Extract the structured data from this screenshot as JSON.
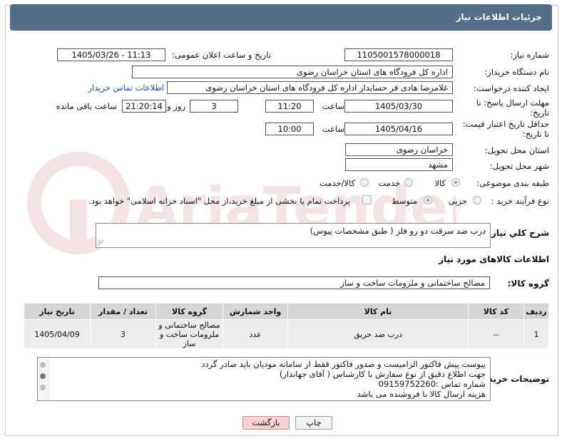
{
  "header": {
    "title": "جزئیات اطلاعات نیاز"
  },
  "fields": {
    "need_number_label": "شماره نیاز:",
    "need_number": "1105001578000018",
    "announce_label": "تاریخ و ساعت اعلان عمومی:",
    "announce_value": "1405/03/26 - 11:13",
    "buyer_org_label": "نام دستگاه خریدار:",
    "buyer_org": "اداره کل فرودگاه های استان خراسان رضوی",
    "creator_label": "ایجاد کننده درخواست:",
    "creator": "غلامرضا هادی قر حسابدار اداره کل فرودگاه های استان خراسان رضوی",
    "buyer_contact_link": "اطلاعات تماس خریدار",
    "reply_deadline_label": "مهلت ارسال پاسخ: تا تاریخ:",
    "reply_date": "1405/03/30",
    "time_label": "ساعت",
    "reply_time": "11:20",
    "days_value": "3",
    "days_label": "روز و",
    "remaining_time": "21:20:14",
    "remaining_label": "ساعت باقی مانده",
    "price_deadline_label": "حداقل تاریخ اعتبار قیمت: تا تاریخ:",
    "price_date": "1405/04/16",
    "price_time": "10:00",
    "province_label": "استان محل تحویل:",
    "province": "خراسان رضوی",
    "city_label": "شهر محل تحویل:",
    "city": "مشهد",
    "category_label": "طبقه بندی موضوعی:",
    "category_options": [
      "کالا",
      "خدمت",
      "کالا/خدمت"
    ],
    "process_label": "نوع فرآیند خرید :",
    "process_options": [
      "جزیی",
      "متوسط"
    ],
    "payment_note": "پرداخت تمام یا بخشی از مبلغ خرید،از محل \"اسناد خزانه اسلامی\" خواهد بود."
  },
  "general_desc": {
    "label": "شرح کلي نیاز:",
    "value": "درب ضد سرقت دو رو فلز ( طبق مشخصات پیوس)"
  },
  "goods_section": {
    "title": "اطلاعات کالاهای مورد نیاز",
    "group_label": "گروه کالا:",
    "group_value": "مصالح ساختمانی و ملزومات ساخت و ساز"
  },
  "table": {
    "headers": [
      "ردیف",
      "کد کالا",
      "نام کالا",
      "واحد شمارش",
      "گروه کالا",
      "تعداد / مقدار",
      "تاریخ نیاز"
    ],
    "rows": [
      [
        "1",
        "--",
        "درب ضد حریق",
        "عدد",
        "مصالح ساختمانی و ملزومات ساخت و ساز",
        "3",
        "1405/04/09"
      ]
    ]
  },
  "buyer_notes": {
    "label": "توضیحات خریدار:",
    "lines": [
      "پیوست پیش فاکتور الزامیست و صدور فاکتور فقط از سامانه مودیان باید صادر گردد",
      "جهت اطلاع دقیق از نوع سفارش با کارشناس  ( آقای جهاندار)",
      "شماره تماس :09159752260",
      "هزینه ارسال کالا با فروشنده می باشد"
    ]
  },
  "buttons": {
    "print": "چاپ",
    "back": "بازگشت"
  },
  "watermark": {
    "text": "AriaTender.net"
  }
}
